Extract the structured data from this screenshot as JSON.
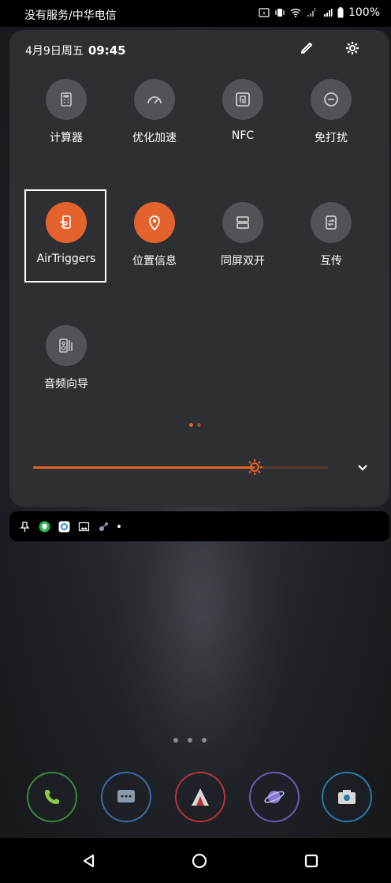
{
  "status_bar": {
    "carrier": "没有服务/中华电信",
    "battery": "100%",
    "icons": [
      "auto-brightness-icon",
      "vibrate-icon",
      "wifi-icon",
      "signal-sim1-icon",
      "signal-4g-icon",
      "battery-icon"
    ]
  },
  "qs_header": {
    "date": "4月9日周五",
    "time": "09:45",
    "edit_icon": "pencil-icon",
    "settings_icon": "gear-icon"
  },
  "tiles": [
    {
      "label": "计算器",
      "icon": "calculator-icon",
      "active": false
    },
    {
      "label": "优化加速",
      "icon": "speedometer-icon",
      "active": false
    },
    {
      "label": "NFC",
      "icon": "nfc-icon",
      "active": false
    },
    {
      "label": "免打扰",
      "icon": "do-not-disturb-icon",
      "active": false
    },
    {
      "label": "AirTriggers",
      "icon": "airtriggers-icon",
      "active": true
    },
    {
      "label": "位置信息",
      "icon": "location-pin-icon",
      "active": true
    },
    {
      "label": "同屏双开",
      "icon": "split-screen-icon",
      "active": false
    },
    {
      "label": "互传",
      "icon": "file-transfer-icon",
      "active": false
    },
    {
      "label": "音频向导",
      "icon": "audio-wizard-icon",
      "active": false
    }
  ],
  "brightness": {
    "level": 0.75
  },
  "notifications": [
    "pin-icon",
    "shield-app-icon",
    "chat-app-icon",
    "gallery-icon",
    "game-icon"
  ],
  "dock_apps": [
    {
      "name": "phone-app-icon",
      "color": "#3a8a3a"
    },
    {
      "name": "messages-app-icon",
      "color": "#3a6aa8"
    },
    {
      "name": "browser-app-icon",
      "color": "#b8333a"
    },
    {
      "name": "planet-app-icon",
      "color": "#6a5ab8"
    },
    {
      "name": "camera-app-icon",
      "color": "#2a7aa8"
    }
  ],
  "nav": [
    "back-icon",
    "home-icon",
    "recents-icon"
  ],
  "colors": {
    "accent": "#e4622c",
    "tile_off": "#505357",
    "panel": "#2d2f32"
  }
}
